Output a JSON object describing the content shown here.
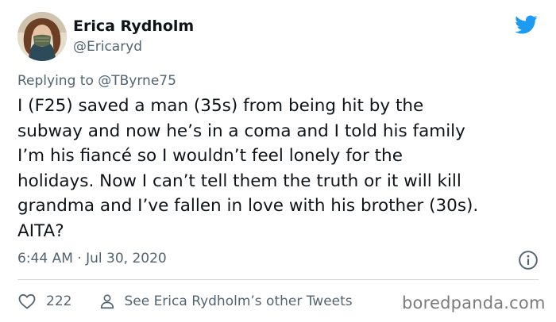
{
  "tweet": {
    "author_name": "Erica Rydholm",
    "author_handle": "@Ericaryd",
    "reply_prefix": "Replying to",
    "reply_to": "@TByrne75",
    "lines": [
      "I (F25) saved a man (35s) from being hit by the",
      "subway and now he’s in a coma and I told his family",
      "I’m his fiancé so I wouldn’t feel lonely for the",
      "holidays. Now I can’t tell them the truth or it will kill",
      "grandma and I’ve fallen in love with his brother (30s).",
      "AITA?"
    ],
    "timestamp": "6:44 AM · Jul 30, 2020",
    "like_count": "222",
    "see_more_label": "See Erica Rydholm’s other Tweets"
  },
  "watermark": "boredpanda.com",
  "icons": {
    "brand": "twitter-bird-icon",
    "info": "info-icon",
    "like": "heart-icon",
    "profile": "person-icon"
  },
  "colors": {
    "brand": "#1d9bf0",
    "text": "#0f1419",
    "muted": "#536471",
    "divider": "#d5dbe0"
  }
}
